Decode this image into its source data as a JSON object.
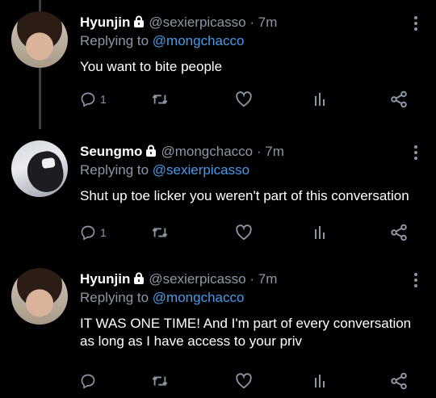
{
  "colors": {
    "background": "#000000",
    "text": "#e7e9ea",
    "muted": "#8b98a5",
    "mention": "#4a99e9"
  },
  "tweets": [
    {
      "name": "Hyunjin",
      "handle": "@sexierpicasso",
      "dot": "·",
      "time": "7m",
      "replying_prefix": "Replying to ",
      "replying_to": "@mongchacco",
      "text": "You want to bite people",
      "reply_count": "1",
      "avatar_icon": "profile-photo"
    },
    {
      "name": "Seungmo",
      "handle": "@mongchacco",
      "dot": "·",
      "time": "7m",
      "replying_prefix": "Replying to ",
      "replying_to": "@sexierpicasso",
      "text": "Shut up toe licker you weren't part of this conversation",
      "reply_count": "1",
      "avatar_icon": "profile-photo"
    },
    {
      "name": "Hyunjin",
      "handle": "@sexierpicasso",
      "dot": "·",
      "time": "7m",
      "replying_prefix": "Replying to ",
      "replying_to": "@mongchacco",
      "text": "IT WAS ONE TIME! And I'm part of every conversation as long as I have access to your priv",
      "reply_count": "",
      "avatar_icon": "profile-photo"
    }
  ],
  "icons": [
    "lock-icon",
    "more-icon",
    "reply-icon",
    "retweet-icon",
    "like-icon",
    "stats-icon",
    "share-icon"
  ]
}
